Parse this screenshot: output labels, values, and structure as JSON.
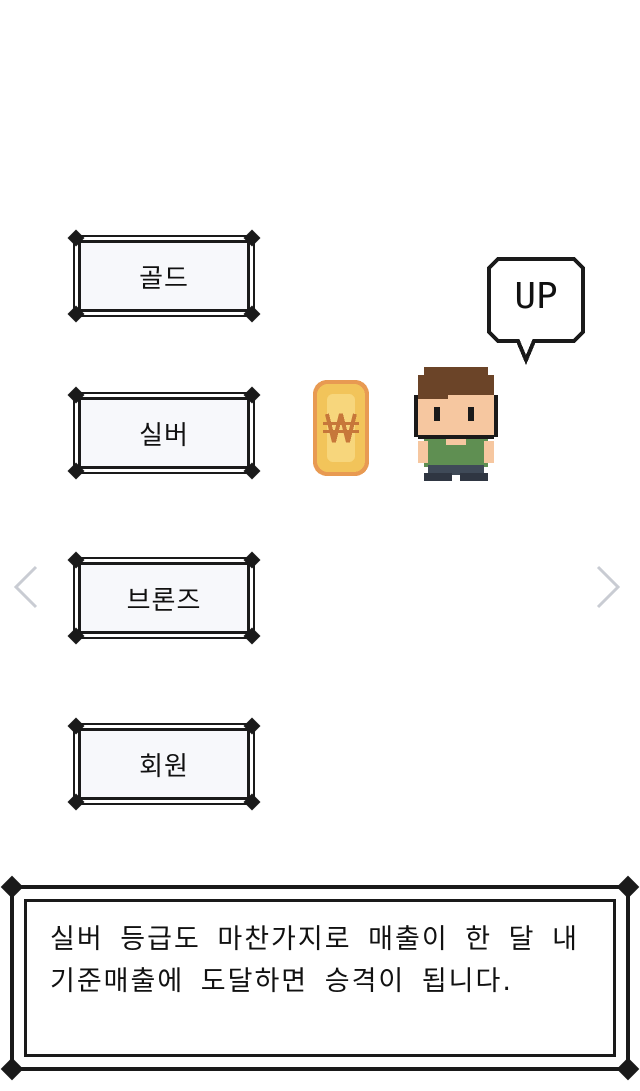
{
  "tiers": [
    {
      "label": "골드"
    },
    {
      "label": "실버"
    },
    {
      "label": "브론즈"
    },
    {
      "label": "회원"
    }
  ],
  "bubble": {
    "text": "UP"
  },
  "dialog": {
    "line1": "실버 등급도 마찬가지로 매출이 한 달 내",
    "line2": "기준매출에 도달하면 승격이 됩니다."
  },
  "colors": {
    "coin_fill": "#f2c45a",
    "coin_border": "#e89a52",
    "hair": "#6b4428",
    "skin": "#f6c7a0",
    "shirt": "#5f8f52",
    "pants": "#3f4a58"
  },
  "icons": {
    "prev": "chevron-left-icon",
    "next": "chevron-right-icon",
    "coin": "won-coin-icon",
    "character": "pixel-character"
  }
}
